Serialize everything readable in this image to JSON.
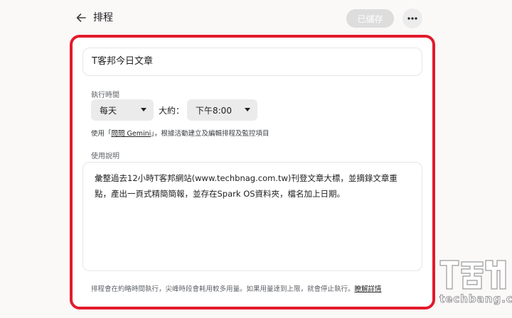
{
  "header": {
    "title": "排程",
    "saved_label": "已儲存"
  },
  "form": {
    "name_value": "T客邦今日文章",
    "time_label": "執行時間",
    "frequency": "每天",
    "about_label": "大約：",
    "time_value": "下午8:00",
    "hint_prefix": "使用「",
    "hint_link": "問問 Gemini",
    "hint_suffix": "」，根據活動建立及編輯排程及監控項目",
    "desc_label": "使用說明",
    "desc_value": "彙整過去12小時T客邦網站(www.techbnag.com.tw)刊登文章大標，並摘錄文章重點，產出一頁式精簡簡報，並存在Spark OS資料夾，檔名加上日期。",
    "footer_text": "排程會在約略時間執行，尖峰時段會耗用較多用量。如果用量達到上限，就會停止執行。",
    "footer_link": "瞭解詳情"
  },
  "watermark": {
    "logo_text": "T客邦",
    "domain": "techbang.com"
  },
  "colors": {
    "frame": "#e21b2c",
    "select_bg": "#ebebeb",
    "saved_bg": "#dddddd"
  },
  "icons": {
    "back": "arrow-left-icon",
    "more": "more-horizontal-icon"
  }
}
